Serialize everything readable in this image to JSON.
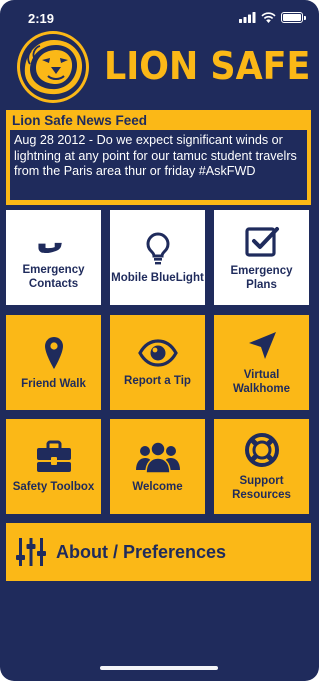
{
  "status_bar": {
    "time": "2:19"
  },
  "header": {
    "title": "LION SAFE"
  },
  "news": {
    "title": "Lion Safe News Feed",
    "body": "Aug 28 2012 - Do we expect significant winds or lightning at any point for our tamuc student travelrs from the Paris area thur or friday #AskFWD"
  },
  "tiles": [
    {
      "label": "Emergency Contacts",
      "icon": "phone-icon"
    },
    {
      "label": "Mobile BlueLight",
      "icon": "lightbulb-icon"
    },
    {
      "label": "Emergency Plans",
      "icon": "checkbox-icon"
    },
    {
      "label": "Friend Walk",
      "icon": "map-pin-icon"
    },
    {
      "label": "Report a Tip",
      "icon": "eye-icon"
    },
    {
      "label": "Virtual Walkhome",
      "icon": "navigation-arrow-icon"
    },
    {
      "label": "Safety Toolbox",
      "icon": "toolbox-icon"
    },
    {
      "label": "Welcome",
      "icon": "people-icon"
    },
    {
      "label": "Support Resources",
      "icon": "lifebuoy-icon"
    }
  ],
  "about": {
    "label": "About / Preferences",
    "icon": "sliders-icon"
  },
  "colors": {
    "navy": "#1f2b5c",
    "gold": "#fbb817",
    "white": "#ffffff"
  }
}
